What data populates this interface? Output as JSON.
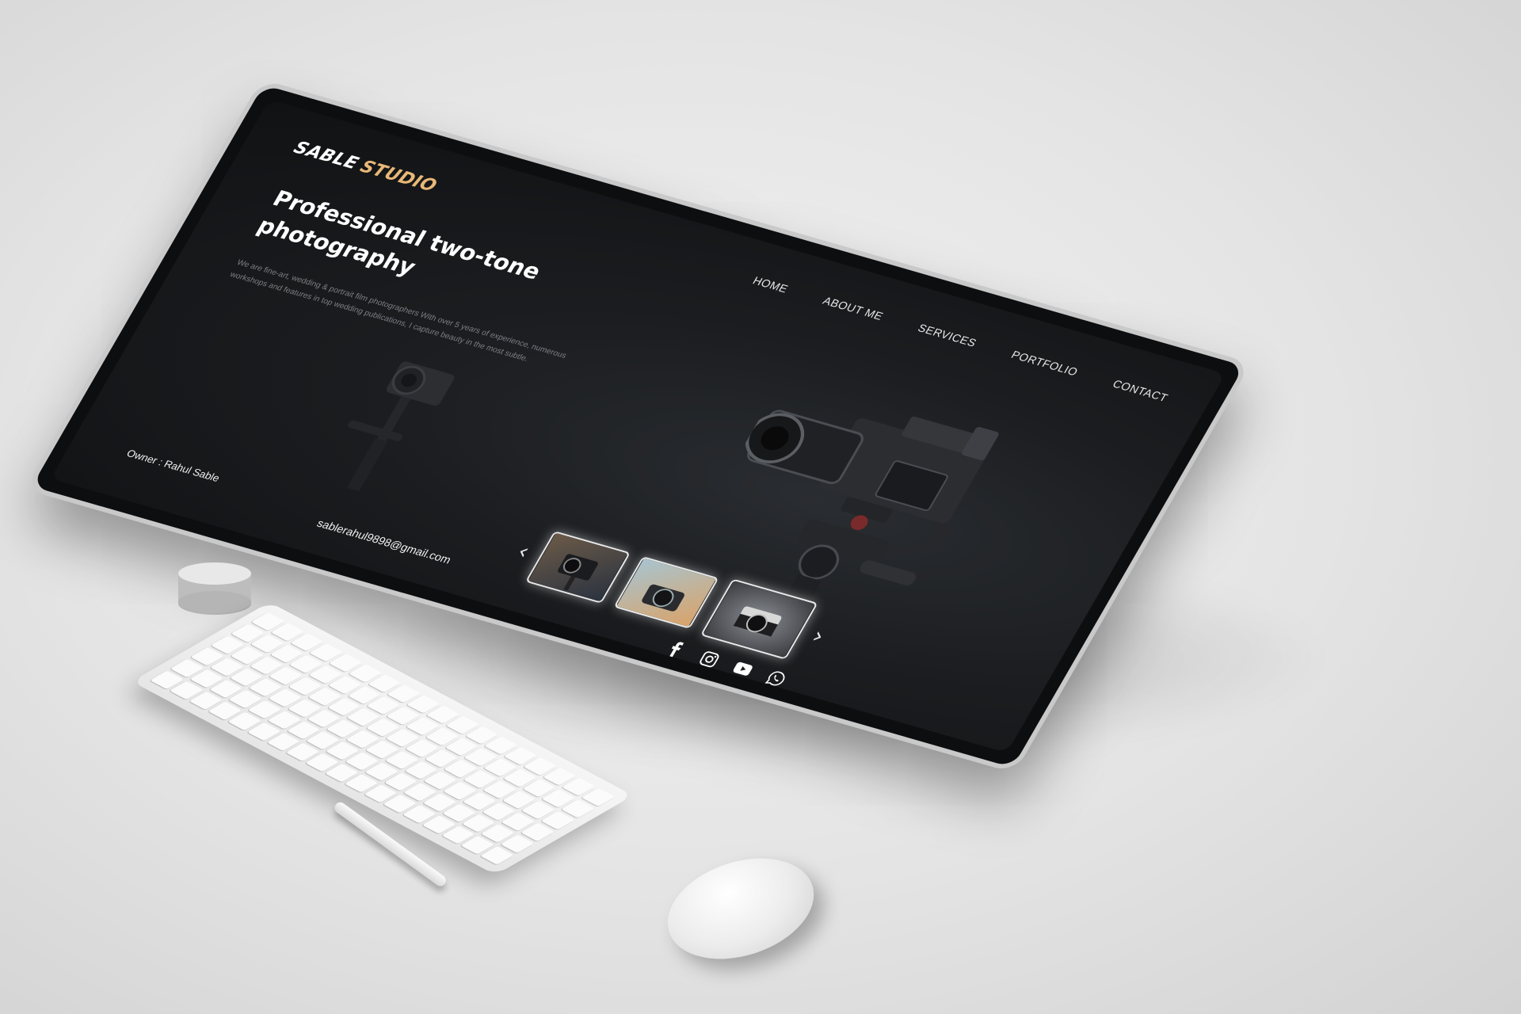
{
  "site": {
    "logo_part1": "SABLE",
    "logo_part2": "STUDIO",
    "accent_color": "#e8b877",
    "background_color": "#1b1d20"
  },
  "nav": {
    "items": [
      {
        "label": "HOME"
      },
      {
        "label": "ABOUT ME"
      },
      {
        "label": "SERVICES"
      },
      {
        "label": "PORTFOLIO"
      },
      {
        "label": "CONTACT"
      }
    ]
  },
  "hero": {
    "headline": "Professional two-tone photography",
    "intro": "We are fine-art, wedding & portrait film photographers With over 5 years of experience, numerous workshops and features in top wedding publications, I capture beauty in the most subtle."
  },
  "footer": {
    "owner": "Owner : Rahul Sable",
    "email": "sablerahul9898@gmail.com"
  },
  "carousel": {
    "prev_icon": "chevron-left-icon",
    "next_icon": "chevron-right-icon",
    "prev_glyph": "‹",
    "next_glyph": "›",
    "thumbnails": [
      {
        "icon": "camera-gimbal-photo"
      },
      {
        "icon": "camera-lens-photo"
      },
      {
        "icon": "vintage-camera-photo"
      }
    ]
  },
  "social": [
    {
      "icon": "facebook-icon"
    },
    {
      "icon": "instagram-icon"
    },
    {
      "icon": "youtube-icon"
    },
    {
      "icon": "whatsapp-icon"
    }
  ]
}
